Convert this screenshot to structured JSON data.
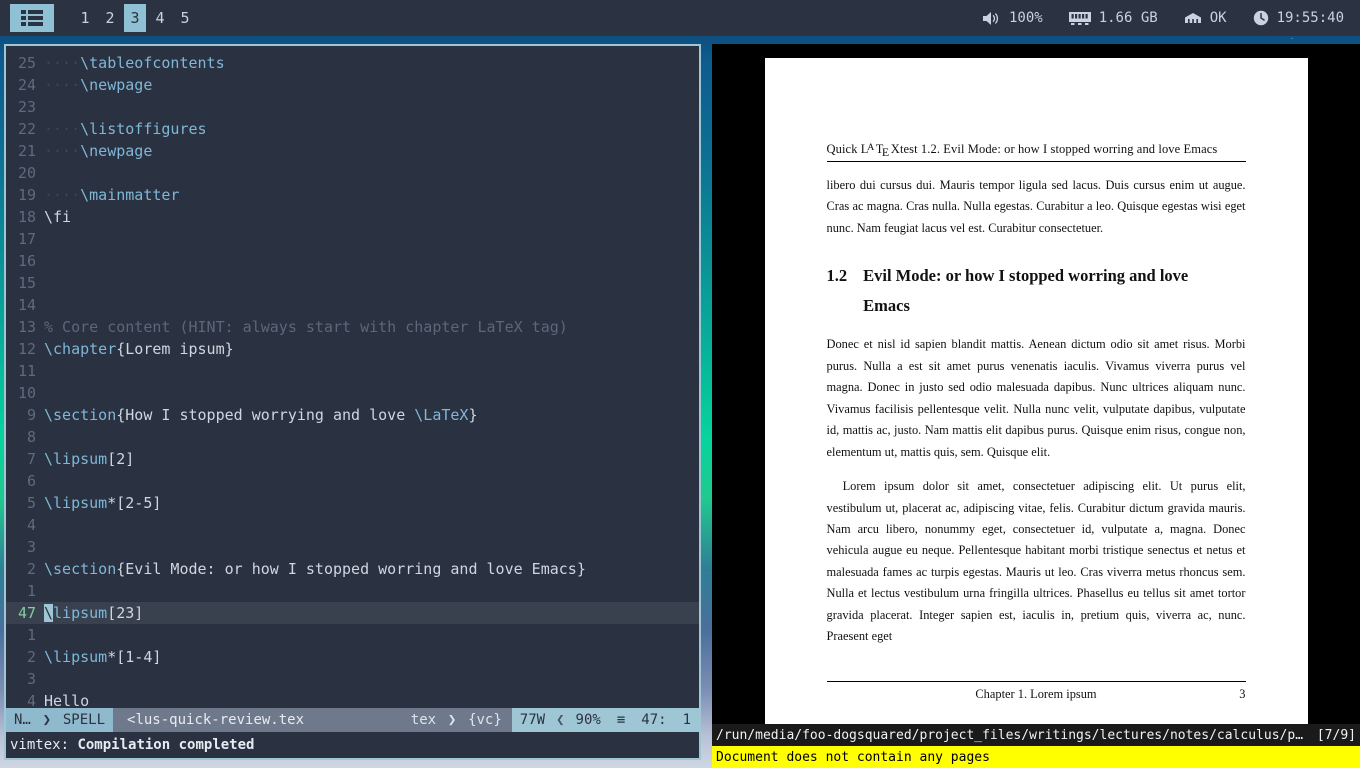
{
  "topbar": {
    "menu_icon": "list-menu-icon",
    "workspaces": [
      {
        "label": "1",
        "active": false
      },
      {
        "label": "2",
        "active": false
      },
      {
        "label": "3",
        "active": true
      },
      {
        "label": "4",
        "active": false
      },
      {
        "label": "5",
        "active": false
      }
    ],
    "tray": {
      "volume_icon": "speaker-volume-icon",
      "volume": "100%",
      "memory_icon": "memory-ram-icon",
      "memory": "1.66 GB",
      "network_icon": "network-icon",
      "network": "OK",
      "clock_icon": "clock-icon",
      "clock": "19:55:40"
    },
    "accent_color": "#8fc0d4",
    "background_color": "#2b3241"
  },
  "editor": {
    "lines": [
      {
        "num": "25",
        "indent": "····",
        "parts": [
          {
            "t": "\\tableofcontents",
            "c": "cmd"
          }
        ]
      },
      {
        "num": "24",
        "indent": "····",
        "parts": [
          {
            "t": "\\newpage",
            "c": "cmd"
          }
        ]
      },
      {
        "num": "23",
        "indent": "",
        "parts": []
      },
      {
        "num": "22",
        "indent": "····",
        "parts": [
          {
            "t": "\\listoffigures",
            "c": "cmd"
          }
        ]
      },
      {
        "num": "21",
        "indent": "····",
        "parts": [
          {
            "t": "\\newpage",
            "c": "cmd"
          }
        ]
      },
      {
        "num": "20",
        "indent": "",
        "parts": []
      },
      {
        "num": "19",
        "indent": "····",
        "parts": [
          {
            "t": "\\mainmatter",
            "c": "cmd"
          }
        ]
      },
      {
        "num": "18",
        "indent": "",
        "parts": [
          {
            "t": "\\fi",
            "c": "code"
          }
        ]
      },
      {
        "num": "17",
        "indent": "",
        "parts": []
      },
      {
        "num": "16",
        "indent": "",
        "parts": []
      },
      {
        "num": "15",
        "indent": "",
        "parts": []
      },
      {
        "num": "14",
        "indent": "",
        "parts": []
      },
      {
        "num": "13",
        "indent": "",
        "parts": [
          {
            "t": "% Core content (HINT: always start with chapter LaTeX tag)",
            "c": "comment"
          }
        ]
      },
      {
        "num": "12",
        "indent": "",
        "parts": [
          {
            "t": "\\chapter",
            "c": "cmd"
          },
          {
            "t": "{Lorem ipsum}",
            "c": "code"
          }
        ]
      },
      {
        "num": "11",
        "indent": "",
        "parts": []
      },
      {
        "num": "10",
        "indent": "",
        "parts": []
      },
      {
        "num": "9",
        "indent": "",
        "parts": [
          {
            "t": "\\section",
            "c": "cmd"
          },
          {
            "t": "{How I stopped worrying and love ",
            "c": "code"
          },
          {
            "t": "\\LaTeX",
            "c": "cmd"
          },
          {
            "t": "}",
            "c": "code"
          }
        ]
      },
      {
        "num": "8",
        "indent": "",
        "parts": []
      },
      {
        "num": "7",
        "indent": "",
        "parts": [
          {
            "t": "\\lipsum",
            "c": "cmd"
          },
          {
            "t": "[2]",
            "c": "code"
          }
        ]
      },
      {
        "num": "6",
        "indent": "",
        "parts": []
      },
      {
        "num": "5",
        "indent": "",
        "parts": [
          {
            "t": "\\lipsum",
            "c": "cmd"
          },
          {
            "t": "*[2-5]",
            "c": "code"
          }
        ]
      },
      {
        "num": "4",
        "indent": "",
        "parts": []
      },
      {
        "num": "3",
        "indent": "",
        "parts": []
      },
      {
        "num": "2",
        "indent": "",
        "parts": [
          {
            "t": "\\section",
            "c": "cmd"
          },
          {
            "t": "{Evil Mode: or how I stopped worring and love Emacs}",
            "c": "code"
          }
        ]
      },
      {
        "num": "1",
        "indent": "",
        "parts": []
      },
      {
        "num": "47",
        "indent": "",
        "cursor": true,
        "parts": [
          {
            "t": "\\",
            "c": "cursor"
          },
          {
            "t": "lipsum",
            "c": "cmd"
          },
          {
            "t": "[23]",
            "c": "code"
          }
        ]
      },
      {
        "num": "1",
        "indent": "",
        "parts": []
      },
      {
        "num": "2",
        "indent": "",
        "parts": [
          {
            "t": "\\lipsum",
            "c": "cmd"
          },
          {
            "t": "*[1-4]",
            "c": "code"
          }
        ]
      },
      {
        "num": "3",
        "indent": "",
        "parts": []
      },
      {
        "num": "4",
        "indent": "",
        "parts": [
          {
            "t": "Hello",
            "c": "code"
          }
        ]
      }
    ],
    "statusline": {
      "mode": "N…",
      "spell": "SPELL",
      "filename": "<lus-quick-review.tex",
      "filetype": "tex",
      "vc": "{vc}",
      "wordcount": "77W",
      "percent": "90%",
      "percent_icon": "≡",
      "position": "47:",
      "column": "1",
      "separator_right": "❯",
      "separator_left": "❮"
    },
    "cmdline_prefix": "vimtex:",
    "cmdline_message": "Compilation completed"
  },
  "pdf": {
    "running_head_prefix": "Quick ",
    "running_head_latex": "LaTeX",
    "running_head_suffix": "test 1.2.  Evil Mode: or how I stopped worring and love Emacs",
    "intro_paragraph": "libero dui cursus dui. Mauris tempor ligula sed lacus. Duis cursus enim ut augue. Cras ac magna. Cras nulla. Nulla egestas. Curabitur a leo. Quisque egestas wisi eget nunc. Nam feugiat lacus vel est. Curabitur consectetuer.",
    "section_number": "1.2",
    "section_title": "Evil Mode: or how I stopped worring and love Emacs",
    "paragraph_1": "Donec et nisl id sapien blandit mattis. Aenean dictum odio sit amet risus. Morbi purus. Nulla a est sit amet purus venenatis iaculis. Vivamus viverra purus vel magna. Donec in justo sed odio malesuada dapibus. Nunc ultrices aliquam nunc. Vivamus facilisis pellentesque velit. Nulla nunc velit, vulputate dapibus, vulputate id, mattis ac, justo. Nam mattis elit dapibus purus. Quisque enim risus, congue non, elementum ut, mattis quis, sem. Quisque elit.",
    "paragraph_2": "Lorem ipsum dolor sit amet, consectetuer adipiscing elit. Ut purus elit, vestibulum ut, placerat ac, adipiscing vitae, felis. Curabitur dictum gravida mauris. Nam arcu libero, nonummy eget, consectetuer id, vulputate a, magna. Donec vehicula augue eu neque. Pellentesque habitant morbi tristique senectus et netus et malesuada fames ac turpis egestas. Mauris ut leo. Cras viverra metus rhoncus sem. Nulla et lectus vestibulum urna fringilla ultrices. Phasellus eu tellus sit amet tortor gravida placerat. Integer sapien est, iaculis in, pretium quis, viverra ac, nunc. Praesent eget",
    "footer_chapter": "Chapter 1.  Lorem ipsum",
    "footer_pagenum": "3",
    "statusbar_path": "/run/media/foo-dogsquared/project_files/writings/lectures/notes/calculus/precalculu…",
    "statusbar_pages": "[7/9]",
    "warning_message": "Document does not contain any pages",
    "warning_color": "#ffff00"
  }
}
